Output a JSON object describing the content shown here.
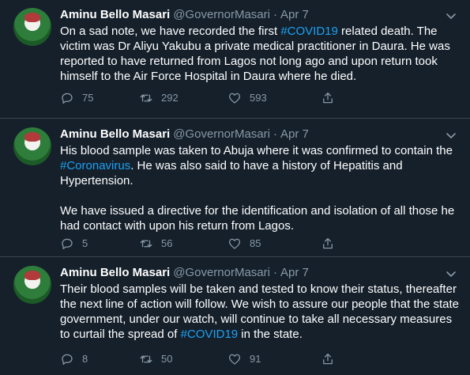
{
  "tweets": [
    {
      "name": "Aminu Bello Masari",
      "handle": "@GovernorMasari",
      "separator": "·",
      "date": "Apr 7",
      "text_before": "On a sad note, we have recorded the first ",
      "hashtag": "#COVID19",
      "text_after": " related death. The victim was Dr Aliyu Yakubu a private medical practitioner in Daura. He was reported to have returned from Lagos not long ago and upon return took himself to the Air Force Hospital in Daura where he died.",
      "replies": "75",
      "retweets": "292",
      "likes": "593"
    },
    {
      "name": "Aminu Bello Masari",
      "handle": "@GovernorMasari",
      "separator": "·",
      "date": "Apr 7",
      "text_before": "His blood sample was taken to Abuja where it was confirmed to contain the ",
      "hashtag": "#Coronavirus",
      "text_after": ". He was also said to have a history of Hepatitis and Hypertension.",
      "paragraph2": "We have issued a directive for the identification and isolation of all those he had contact with upon his return from Lagos.",
      "replies": "5",
      "retweets": "56",
      "likes": "85"
    },
    {
      "name": "Aminu Bello Masari",
      "handle": "@GovernorMasari",
      "separator": "·",
      "date": "Apr 7",
      "text_before": "Their blood samples will be taken and tested to know their status, thereafter the next line of action will follow. We wish to assure our people that the state government, under our watch, will continue to take all necessary measures to curtail the spread of ",
      "hashtag": "#COVID19",
      "text_after": " in the state.",
      "replies": "8",
      "retweets": "50",
      "likes": "91"
    }
  ],
  "colors": {
    "background": "#15202b",
    "text": "#ffffff",
    "muted": "#8899a6",
    "link": "#1da1f2",
    "divider": "#38444d"
  },
  "icons": {
    "reply": "reply-icon",
    "retweet": "retweet-icon",
    "like": "like-icon",
    "share": "share-icon",
    "more": "chevron-down-icon"
  }
}
